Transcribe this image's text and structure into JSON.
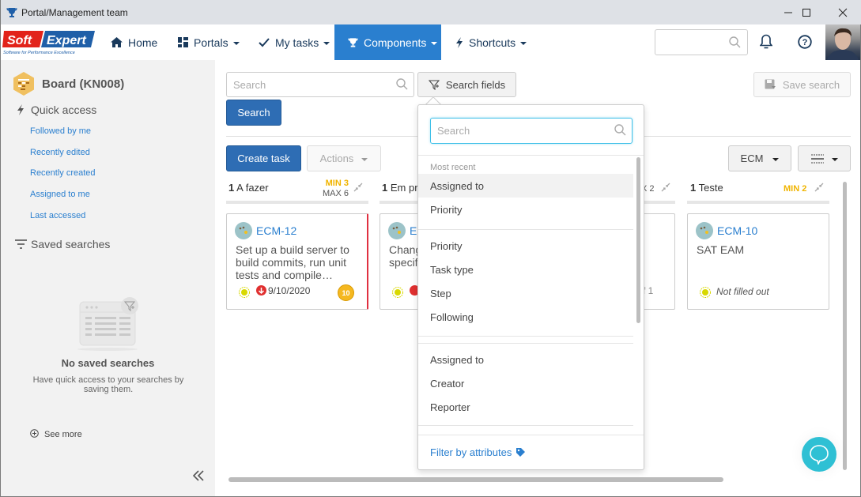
{
  "window": {
    "title": "Portal/Management team",
    "controls": [
      "minimize",
      "maximize",
      "close"
    ]
  },
  "nav": {
    "logo_text": "SoftExpert",
    "logo_tagline": "Software for Performance Excellence",
    "items": [
      {
        "label": "Home",
        "icon": "home-icon",
        "dropdown": false,
        "active": false
      },
      {
        "label": "Portals",
        "icon": "grid-icon",
        "dropdown": true,
        "active": false
      },
      {
        "label": "My tasks",
        "icon": "check-icon",
        "dropdown": true,
        "active": false
      },
      {
        "label": "Components",
        "icon": "trophy-icon",
        "dropdown": true,
        "active": true
      },
      {
        "label": "Shortcuts",
        "icon": "bolt-icon",
        "dropdown": true,
        "active": false
      }
    ],
    "search_placeholder": "",
    "accent": "#2a7fcf"
  },
  "sidebar": {
    "board_title": "Board (KN008)",
    "quick_access_label": "Quick access",
    "quick_access_items": [
      "Followed by me",
      "Recently edited",
      "Recently created",
      "Assigned to me",
      "Last accessed"
    ],
    "saved_searches_label": "Saved searches",
    "empty_title": "No saved searches",
    "empty_desc": "Have quick access to your searches by saving them.",
    "see_more": "See more"
  },
  "main": {
    "search_placeholder": "Search",
    "search_fields_label": "Search fields",
    "search_button": "Search",
    "save_search_label": "Save search",
    "create_task_label": "Create task",
    "actions_label": "Actions",
    "ecm_label": "ECM",
    "columns": [
      {
        "count": "1",
        "name": "A fazer",
        "min_label": "MIN",
        "min": "3",
        "max_label": "MAX",
        "max": "6"
      },
      {
        "count": "1",
        "name": "Em pr",
        "max_partial": "X 2"
      },
      {
        "count": "1",
        "name": "Teste",
        "min_label": "MIN",
        "min": "2"
      }
    ],
    "cards": [
      {
        "id": "ECM-12",
        "text": "Set up a build server to build commits, run unit tests and compile…",
        "date": "9/10/2020",
        "badge": "10",
        "flagged": true
      },
      {
        "id": "E",
        "text": "Chang specif",
        "partial": true
      },
      {
        "partial_text": "f 1"
      },
      {
        "id": "ECM-10",
        "text": "SAT EAM",
        "status_text": "Not filled out"
      }
    ]
  },
  "dropdown": {
    "search_placeholder": "Search",
    "most_recent_label": "Most recent",
    "most_recent": [
      "Assigned to",
      "Priority"
    ],
    "group1": [
      "Priority",
      "Task type",
      "Step",
      "Following"
    ],
    "group2": [
      "Assigned to",
      "Creator",
      "Reporter"
    ],
    "footer": "Filter by attributes"
  }
}
